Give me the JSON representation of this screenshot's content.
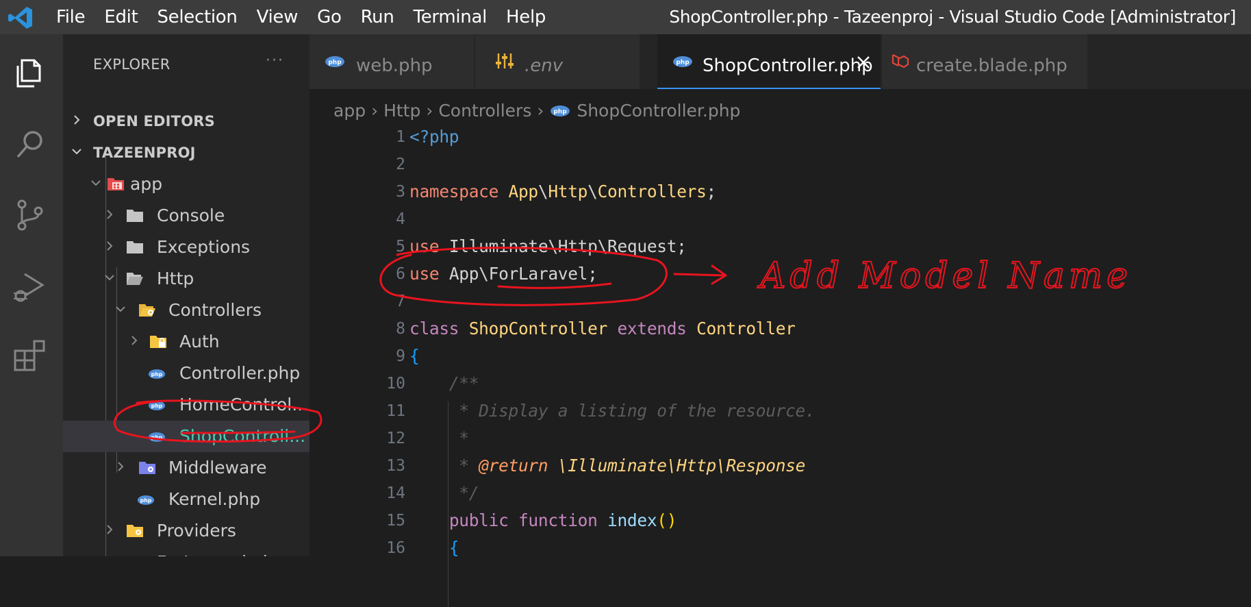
{
  "titlebar": {
    "menu": [
      "File",
      "Edit",
      "Selection",
      "View",
      "Go",
      "Run",
      "Terminal",
      "Help"
    ],
    "window_title": "ShopController.php - Tazeenproj - Visual Studio Code [Administrator]"
  },
  "activity": {
    "items": [
      "explorer-icon",
      "search-icon",
      "source-control-icon",
      "run-debug-icon",
      "extensions-icon"
    ]
  },
  "sidebar": {
    "header": "EXPLORER",
    "more": "···",
    "tree": [
      {
        "label": "OPEN EDITORS"
      },
      {
        "label": "TAZEENPROJ"
      },
      {
        "label": "app"
      },
      {
        "label": "Console"
      },
      {
        "label": "Exceptions"
      },
      {
        "label": "Http"
      },
      {
        "label": "Controllers"
      },
      {
        "label": "Auth"
      },
      {
        "label": "Controller.php"
      },
      {
        "label": "HomeControl..."
      },
      {
        "label": "ShopControll..."
      },
      {
        "label": "Middleware"
      },
      {
        "label": "Kernel.php"
      },
      {
        "label": "Providers"
      },
      {
        "label": "ForLaravel.php"
      }
    ]
  },
  "tabs": [
    {
      "label": "web.php"
    },
    {
      "label": ".env"
    },
    {
      "label": "ShopController.php"
    },
    {
      "label": "create.blade.php"
    }
  ],
  "breadcrumb": [
    "app",
    "Http",
    "Controllers",
    "ShopController.php"
  ],
  "code": {
    "line_numbers": [
      "1",
      "2",
      "3",
      "4",
      "5",
      "6",
      "7",
      "8",
      "9",
      "10",
      "11",
      "12",
      "13",
      "14",
      "15",
      "16"
    ],
    "lines": [
      "<?php",
      "",
      "namespace App\\Http\\Controllers;",
      "",
      "use Illuminate\\Http\\Request;",
      "use App\\ForLaravel;",
      "",
      "class ShopController extends Controller",
      "{",
      "    /**",
      "     * Display a listing of the resource.",
      "     *",
      "     * @return \\Illuminate\\Http\\Response",
      "     */",
      "    public function index()",
      "    {"
    ]
  },
  "annotation": {
    "handwritten_note": "Add Model Name",
    "accent_color": "#e8141e"
  }
}
